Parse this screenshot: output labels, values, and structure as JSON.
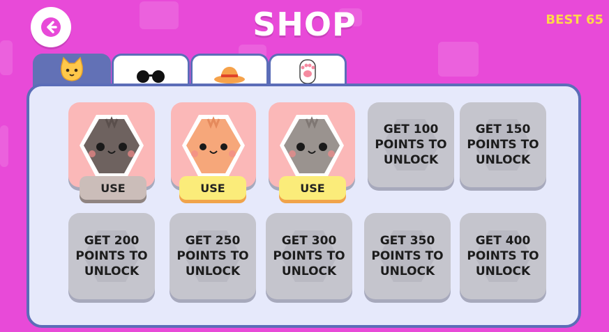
{
  "header": {
    "title": "SHOP",
    "best_label": "BEST 65"
  },
  "tabs": [
    {
      "name": "cats",
      "icon": "cat-face-icon",
      "active": true
    },
    {
      "name": "glasses",
      "icon": "sunglasses-icon",
      "active": false
    },
    {
      "name": "hats",
      "icon": "hat-icon",
      "active": false
    },
    {
      "name": "paws",
      "icon": "paw-icon",
      "active": false
    }
  ],
  "owned_cats": [
    {
      "fur": "#6e625f",
      "use_label": "USE",
      "button_style": "gray"
    },
    {
      "fur": "#f6a77a",
      "use_label": "USE",
      "button_style": "yellow"
    },
    {
      "fur": "#9a938f",
      "use_label": "USE",
      "button_style": "yellow"
    }
  ],
  "locked_cats": [
    "GET 100 POINTS TO UNLOCK",
    "GET 150 POINTS TO UNLOCK",
    "GET 200 POINTS TO UNLOCK",
    "GET 250 POINTS TO UNLOCK",
    "GET 300 POINTS TO UNLOCK",
    "GET 350 POINTS TO UNLOCK",
    "GET 400 POINTS TO UNLOCK"
  ],
  "colors": {
    "background": "#e84ad8",
    "panel": "#e6e9fb",
    "panel_border": "#5b6db8",
    "best": "#ffd84a",
    "use_yellow": "#fbec7a",
    "owned_slot": "#fbb8b8",
    "locked_slot": "#c5c5cd"
  }
}
